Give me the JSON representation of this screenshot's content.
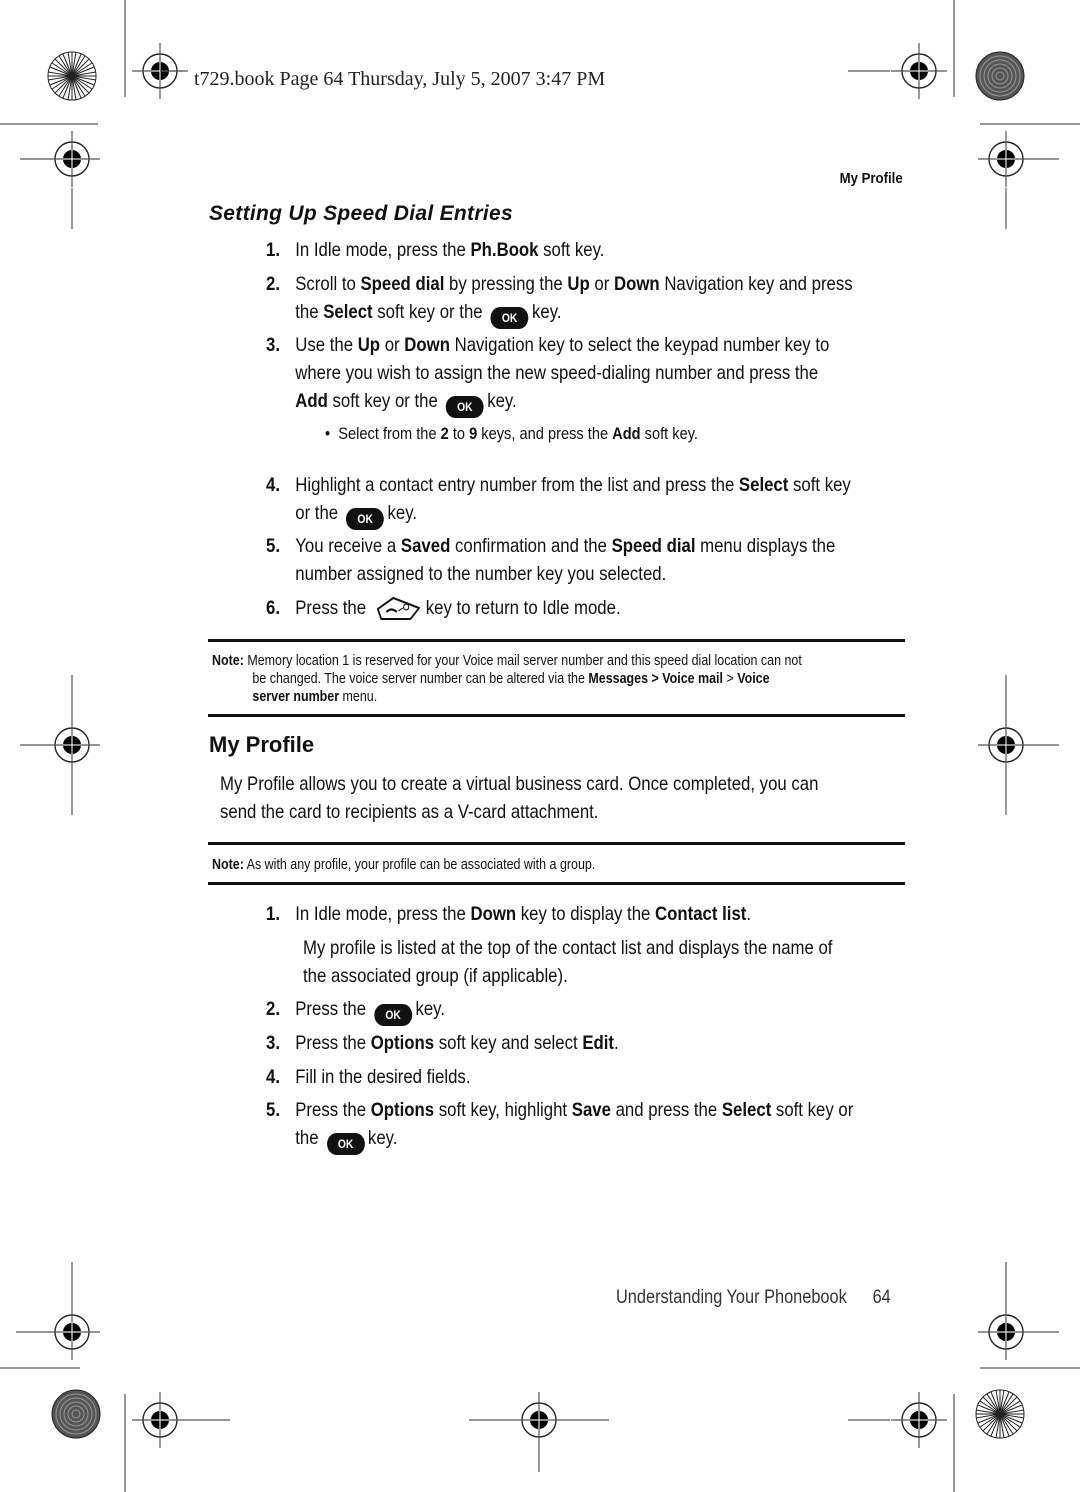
{
  "slug": "t729.book  Page 64  Thursday, July 5, 2007  3:47 PM",
  "running_head": "My Profile",
  "section1": {
    "heading": "Setting Up Speed Dial Entries",
    "steps": [
      {
        "num": "1.",
        "parts": [
          "In Idle mode, press the ",
          "Ph.Book",
          " soft key."
        ]
      },
      {
        "num": "2.",
        "line1": [
          "Scroll to ",
          "Speed dial",
          " by pressing the ",
          "Up",
          " or ",
          "Down",
          " Navigation key and press"
        ],
        "line2": [
          "the ",
          "Select",
          " soft key or the ",
          "key."
        ]
      },
      {
        "num": "3.",
        "line1": [
          "Use the ",
          "Up",
          " or ",
          "Down",
          " Navigation key to select the keypad number key to"
        ],
        "line2": "where you wish to assign the new speed-dialing number and press the",
        "line3": [
          "Add",
          " soft key or the ",
          "key."
        ]
      },
      {
        "num": "4.",
        "line1": [
          "Highlight a contact entry number from the list and press the ",
          "Select",
          " soft key"
        ],
        "line2": [
          "or the ",
          "key."
        ]
      },
      {
        "num": "5.",
        "line1": [
          "You receive a ",
          "Saved",
          " confirmation and the ",
          "Speed dial",
          " menu displays the"
        ],
        "line2": "number assigned to the number key you selected."
      },
      {
        "num": "6.",
        "parts": [
          "Press the ",
          "key to return to Idle mode."
        ]
      }
    ],
    "bullet": [
      "Select from the ",
      "2",
      " to ",
      "9",
      " keys, and press the ",
      "Add",
      " soft key."
    ]
  },
  "note1": {
    "label": "Note:",
    "line1": "Memory location 1 is reserved for your Voice mail server number and this speed dial location can not",
    "line2": [
      "be changed. The voice server number can be altered via the ",
      "Messages > Voice mail",
      " > ",
      "Voice"
    ],
    "line3": [
      "server number",
      " menu."
    ]
  },
  "section2": {
    "heading": "My Profile",
    "intro_line1": "My Profile allows you to create a virtual business card. Once completed, you can",
    "intro_line2": "send the card to recipients as a V-card attachment.",
    "steps": [
      {
        "num": "1.",
        "parts": [
          "In Idle mode, press the ",
          "Down",
          " key to display the ",
          "Contact list",
          "."
        ],
        "sub1": "My profile is listed at the top of the contact list and displays the name of",
        "sub2": "the associated group (if applicable)."
      },
      {
        "num": "2.",
        "parts": [
          "Press the ",
          "key."
        ]
      },
      {
        "num": "3.",
        "parts": [
          "Press the ",
          "Options",
          " soft key and select ",
          "Edit",
          "."
        ]
      },
      {
        "num": "4.",
        "parts": [
          "Fill in the desired fields."
        ]
      },
      {
        "num": "5.",
        "line1": [
          "Press the ",
          "Options",
          " soft key, highlight ",
          "Save",
          " and press the ",
          "Select",
          " soft key or"
        ],
        "line2": [
          "the ",
          "key."
        ]
      }
    ]
  },
  "note2": {
    "label": "Note:",
    "text": " As with any profile, your profile can be associated with a group."
  },
  "icons": {
    "ok_key": "OK",
    "end_key": "end-call-key"
  },
  "footer": {
    "chapter": "Understanding Your Phonebook",
    "page_number": "64"
  }
}
